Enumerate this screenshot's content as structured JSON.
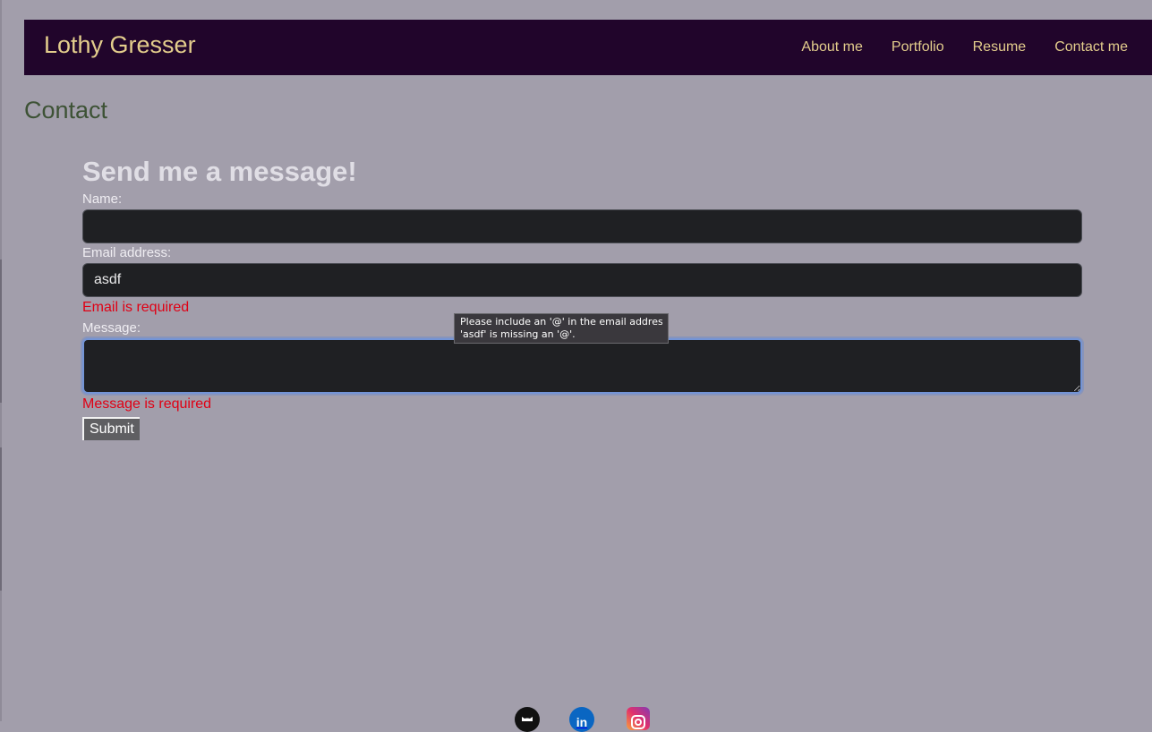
{
  "header": {
    "brand": "Lothy Gresser",
    "nav": [
      "About me",
      "Portfolio",
      "Resume",
      "Contact me"
    ]
  },
  "section_title": "Contact",
  "form": {
    "heading": "Send me a message!",
    "name_label": "Name:",
    "name_value": "",
    "email_label": "Email address:",
    "email_value": "asdf",
    "email_error": "Email is required",
    "message_label": "Message:",
    "message_value": "",
    "message_error": "Message is required",
    "submit_label": "Submit"
  },
  "validation_tooltip": {
    "line1": "Please include an '@' in the email address.",
    "line2": "'asdf' is missing an '@'."
  },
  "footer": {
    "icons": [
      "github-icon",
      "linkedin-icon",
      "instagram-icon"
    ],
    "linkedin_text": "in"
  },
  "colors": {
    "background": "#a29eab",
    "header_bg": "#21052b",
    "accent_text": "#e3cd8c",
    "section_title": "#3d5235",
    "error": "#e00014"
  }
}
